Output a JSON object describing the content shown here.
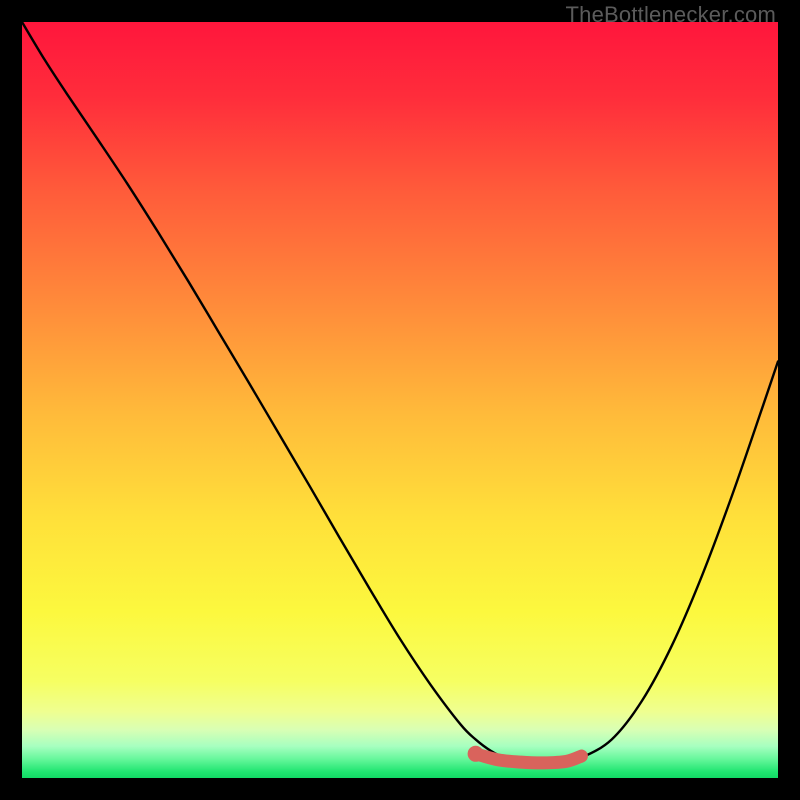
{
  "watermark": "TheBottlenecker.com",
  "colors": {
    "gradient_top": "#ff163c",
    "gradient_mid1": "#ff6a3a",
    "gradient_mid2": "#ffc23a",
    "gradient_mid3": "#fcf63a",
    "gradient_low": "#f2ff7a",
    "gradient_band": "#d6ffb0",
    "gradient_bottom": "#17e86a",
    "curve": "#000000",
    "marker": "#d9635c",
    "frame": "#000000"
  },
  "chart_data": {
    "type": "line",
    "title": "",
    "xlabel": "",
    "ylabel": "",
    "xlim": [
      0,
      100
    ],
    "ylim": [
      0,
      100
    ],
    "series": [
      {
        "name": "bottleneck-curve",
        "x": [
          0,
          3,
          6,
          10,
          14,
          18,
          22,
          26,
          30,
          34,
          38,
          42,
          46,
          50,
          54,
          58,
          60,
          62,
          64,
          67,
          71,
          74,
          78,
          82,
          86,
          90,
          94,
          98,
          100
        ],
        "y": [
          100,
          95,
          90.4,
          84.5,
          78.5,
          72.2,
          65.7,
          59,
          52.3,
          45.5,
          38.7,
          31.8,
          25,
          18.4,
          12.4,
          7.1,
          5.1,
          3.6,
          2.6,
          1.9,
          2.0,
          2.7,
          5.1,
          10.2,
          17.6,
          26.9,
          37.6,
          49.2,
          55.1
        ]
      },
      {
        "name": "optimal-band",
        "x": [
          60,
          63,
          66,
          69,
          72,
          74
        ],
        "y": [
          3.2,
          2.4,
          2.1,
          2.0,
          2.2,
          2.9
        ]
      }
    ],
    "annotations": []
  }
}
